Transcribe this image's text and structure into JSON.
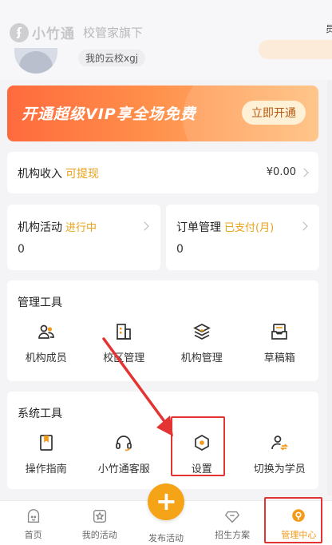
{
  "header": {
    "brand_name": "小竹通",
    "brand_sub": "校管家旗下",
    "school_name": "我的云校xgj",
    "edge_char": "员"
  },
  "vip": {
    "title": "开通超级VIP享全场免费",
    "button_label": "立即开通"
  },
  "income": {
    "label": "机构收入",
    "hint": "可提现",
    "amount": "¥0.00"
  },
  "stats": [
    {
      "label": "机构活动",
      "hint": "进行中",
      "value": "0"
    },
    {
      "label": "订单管理",
      "hint": "已支付(月)",
      "value": "0"
    }
  ],
  "management_tools": {
    "title": "管理工具",
    "items": [
      {
        "label": "机构成员",
        "icon": "members-icon"
      },
      {
        "label": "校区管理",
        "icon": "campus-icon"
      },
      {
        "label": "机构管理",
        "icon": "layers-icon"
      },
      {
        "label": "草稿箱",
        "icon": "drafts-icon"
      }
    ]
  },
  "system_tools": {
    "title": "系统工具",
    "items": [
      {
        "label": "操作指南",
        "icon": "guide-book-icon"
      },
      {
        "label": "小竹通客服",
        "icon": "headset-icon"
      },
      {
        "label": "设置",
        "icon": "settings-hexagon-icon"
      },
      {
        "label": "切换为学员",
        "icon": "switch-user-icon"
      }
    ]
  },
  "bottom_nav": [
    {
      "label": "首页",
      "icon": "home-icon"
    },
    {
      "label": "我的活动",
      "icon": "star-icon"
    },
    {
      "label": "发布活动",
      "icon": "plus-icon"
    },
    {
      "label": "招生方案",
      "icon": "diamond-icon"
    },
    {
      "label": "管理中心",
      "icon": "manage-center-icon"
    }
  ],
  "colors": {
    "accent": "#f39a18",
    "hint": "#e8a21a",
    "highlight": "#e43333",
    "banner_start": "#ff6a3d",
    "banner_end": "#ffbe7a"
  }
}
